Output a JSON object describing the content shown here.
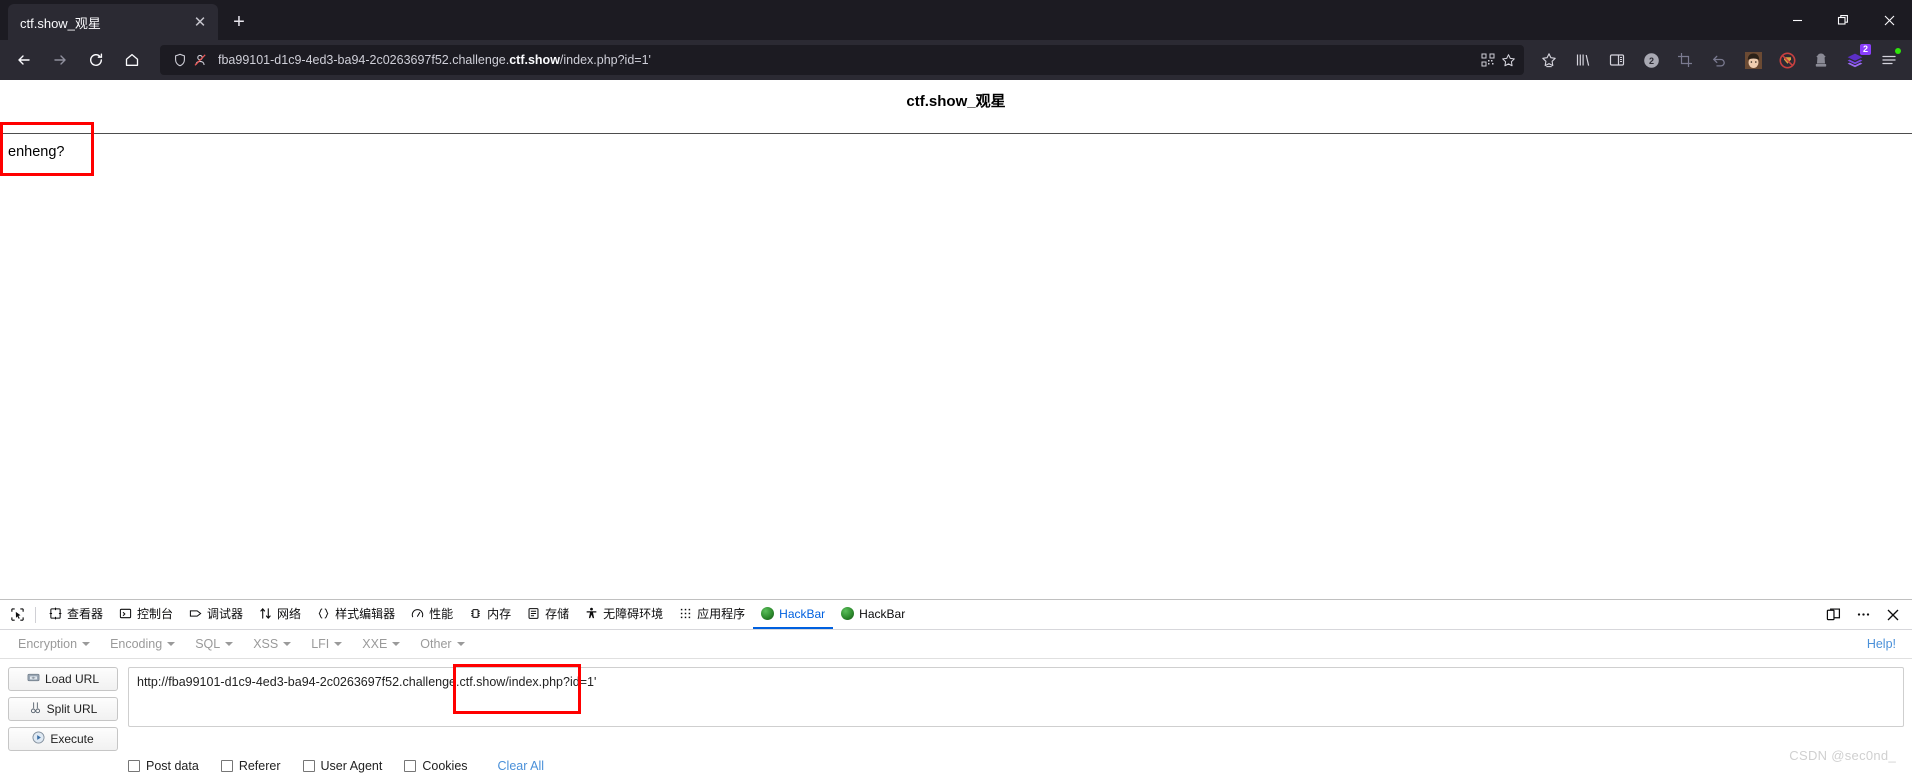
{
  "browser": {
    "tab": {
      "title": "ctf.show_观星",
      "close_icon": "close-icon"
    },
    "newtab_label": "+",
    "window_controls": {
      "minimize": "—",
      "restore": "❐",
      "close": "✕"
    },
    "nav": {
      "back": "back-arrow-icon",
      "forward": "forward-arrow-icon",
      "reload": "reload-icon",
      "home": "home-icon"
    },
    "url": {
      "value": "fba99101-d1c9-4ed3-ba94-2c0263697f52.challenge.ctf.show/index.php?id=1'",
      "prefix": "fba99101-d1c9-4ed3-ba94-2c0263697f52.challenge.",
      "domain_bold": "ctf.show",
      "suffix": "/index.php?id=1'",
      "shield_icon": "shield-icon",
      "tracking_icon": "tracking-protection-off-icon",
      "qr_icon": "qr-code-icon",
      "bookmark_icon": "star-bookmark-icon"
    },
    "extensions": [
      {
        "name": "bookmark-star-icon",
        "glyph": "☆",
        "badge": ""
      },
      {
        "name": "library-icon",
        "glyph": "‖‖",
        "badge": ""
      },
      {
        "name": "sidebar-icon",
        "glyph": "▤",
        "badge": ""
      },
      {
        "name": "counter-icon",
        "glyph": "2",
        "badge": ""
      },
      {
        "name": "screenshot-crop-icon",
        "glyph": "⌧",
        "badge": ""
      },
      {
        "name": "undo-icon",
        "glyph": "↶",
        "badge": ""
      },
      {
        "name": "avatar-extension-icon",
        "glyph": "",
        "badge": ""
      },
      {
        "name": "adblock-off-icon",
        "glyph": "⊘",
        "badge": ""
      },
      {
        "name": "proxy-switcher-icon",
        "glyph": "♟",
        "badge": ""
      },
      {
        "name": "stack-extension-icon",
        "glyph": "◆",
        "badge": "2"
      },
      {
        "name": "app-menu-icon",
        "glyph": "☰",
        "badge": ""
      }
    ]
  },
  "page": {
    "title": "ctf.show_观星",
    "body_text": "enheng?",
    "annotation_box_label": "red-highlight-box"
  },
  "devtools": {
    "picker_icon": "element-picker-icon",
    "tabs": [
      {
        "label": "查看器",
        "icon": "inspector-icon",
        "active": false
      },
      {
        "label": "控制台",
        "icon": "console-icon",
        "active": false
      },
      {
        "label": "调试器",
        "icon": "debugger-icon",
        "active": false
      },
      {
        "label": "网络",
        "icon": "network-icon",
        "active": false
      },
      {
        "label": "样式编辑器",
        "icon": "style-editor-icon",
        "active": false
      },
      {
        "label": "性能",
        "icon": "performance-icon",
        "active": false
      },
      {
        "label": "内存",
        "icon": "memory-icon",
        "active": false
      },
      {
        "label": "存储",
        "icon": "storage-icon",
        "active": false
      },
      {
        "label": "无障碍环境",
        "icon": "accessibility-icon",
        "active": false
      },
      {
        "label": "应用程序",
        "icon": "application-icon",
        "active": false
      },
      {
        "label": "HackBar",
        "icon": "hackbar-icon",
        "active": true
      },
      {
        "label": "HackBar",
        "icon": "hackbar-icon",
        "active": false
      }
    ],
    "right_buttons": [
      {
        "name": "responsive-design-mode-icon",
        "glyph": "❑"
      },
      {
        "name": "devtools-menu-icon",
        "glyph": "⋯"
      },
      {
        "name": "devtools-close-icon",
        "glyph": "✕"
      }
    ],
    "active_tab_color": "#0060df"
  },
  "hackbar": {
    "menus": [
      {
        "label": "Encryption"
      },
      {
        "label": "Encoding"
      },
      {
        "label": "SQL"
      },
      {
        "label": "XSS"
      },
      {
        "label": "LFI"
      },
      {
        "label": "XXE"
      },
      {
        "label": "Other"
      }
    ],
    "help_label": "Help!",
    "buttons": [
      {
        "label": "Load URL",
        "icon": "load-url-icon"
      },
      {
        "label": "Split URL",
        "icon": "scissors-icon"
      },
      {
        "label": "Execute",
        "icon": "execute-play-icon"
      }
    ],
    "url_textarea": {
      "value": "http://fba99101-d1c9-4ed3-ba94-2c0263697f52.challenge.ctf.show/index.php?id=1'",
      "placeholder": ""
    },
    "checkboxes": [
      {
        "label": "Post data",
        "checked": false
      },
      {
        "label": "Referer",
        "checked": false
      },
      {
        "label": "User Agent",
        "checked": false
      },
      {
        "label": "Cookies",
        "checked": false
      }
    ],
    "clear_all_label": "Clear All",
    "link_color": "#4a90d9"
  },
  "watermark": {
    "text": "CSDN @sec0nd_"
  }
}
